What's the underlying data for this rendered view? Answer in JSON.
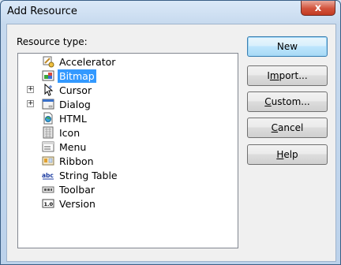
{
  "window": {
    "title": "Add Resource",
    "close_label": "x"
  },
  "tree": {
    "label": "Resource type:",
    "items": [
      {
        "label": "Accelerator",
        "icon": "accelerator-icon",
        "expandable": false,
        "selected": false
      },
      {
        "label": "Bitmap",
        "icon": "bitmap-icon",
        "expandable": false,
        "selected": true
      },
      {
        "label": "Cursor",
        "icon": "cursor-icon",
        "expandable": true,
        "selected": false
      },
      {
        "label": "Dialog",
        "icon": "dialog-icon",
        "expandable": true,
        "selected": false
      },
      {
        "label": "HTML",
        "icon": "html-icon",
        "expandable": false,
        "selected": false
      },
      {
        "label": "Icon",
        "icon": "icon-resource-icon",
        "expandable": false,
        "selected": false
      },
      {
        "label": "Menu",
        "icon": "menu-icon",
        "expandable": false,
        "selected": false
      },
      {
        "label": "Ribbon",
        "icon": "ribbon-icon",
        "expandable": false,
        "selected": false
      },
      {
        "label": "String Table",
        "icon": "string-table-icon",
        "expandable": false,
        "selected": false
      },
      {
        "label": "Toolbar",
        "icon": "toolbar-icon",
        "expandable": false,
        "selected": false
      },
      {
        "label": "Version",
        "icon": "version-icon",
        "expandable": false,
        "selected": false
      }
    ],
    "expander_glyph": "+"
  },
  "buttons": {
    "new": "New",
    "import_pre": "I",
    "import_u": "m",
    "import_post": "port...",
    "custom_pre": "",
    "custom_u": "C",
    "custom_post": "ustom...",
    "cancel_pre": "",
    "cancel_u": "C",
    "cancel_post": "ancel",
    "help_pre": "",
    "help_u": "H",
    "help_post": "elp"
  },
  "colors": {
    "selection": "#3399ff",
    "close_button": "#c23a22"
  }
}
